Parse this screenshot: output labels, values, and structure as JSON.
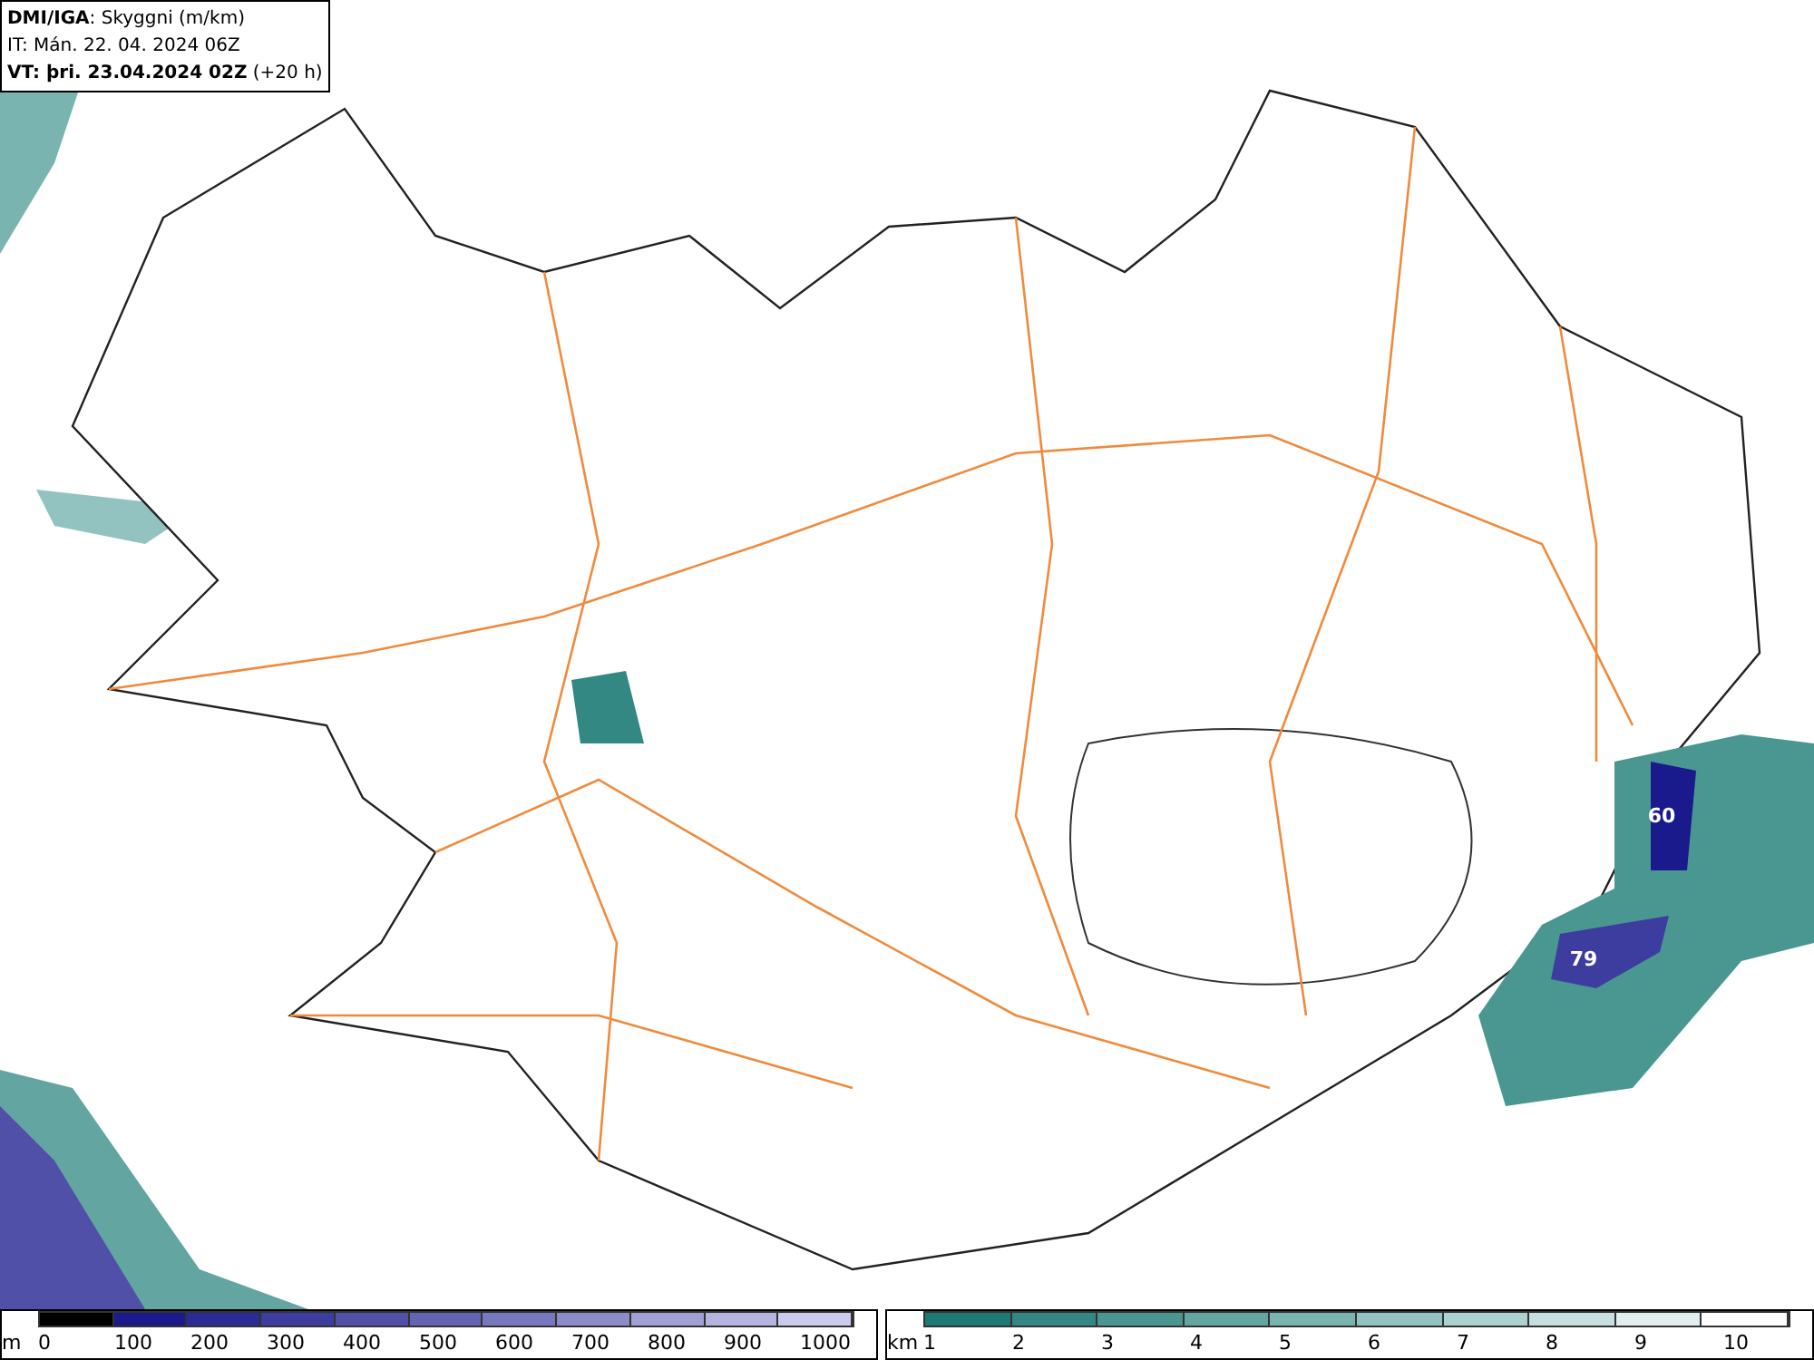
{
  "header": {
    "lines": [
      "**DMI/IGA**: Skyggni (m/km)",
      "IT: Mán. 22. 04. 2024 06Z",
      "**VT: þri. 23.04.2024 02Z** (+20 h)"
    ]
  },
  "map": {
    "labels": [
      {
        "text": "60"
      },
      {
        "text": "79"
      }
    ]
  },
  "legends": [
    {
      "unit": "m",
      "items": [
        {
          "label": "0",
          "color": "#000000"
        },
        {
          "label": "100",
          "color": "#1a1a8c"
        },
        {
          "label": "200",
          "color": "#2b2b96"
        },
        {
          "label": "300",
          "color": "#3d3d9f"
        },
        {
          "label": "400",
          "color": "#5050a8"
        },
        {
          "label": "500",
          "color": "#6464b4"
        },
        {
          "label": "600",
          "color": "#7878bf"
        },
        {
          "label": "700",
          "color": "#8c8cc8"
        },
        {
          "label": "800",
          "color": "#a0a0d4"
        },
        {
          "label": "900",
          "color": "#b4b4df"
        },
        {
          "label": "1000",
          "color": "#cbcbee"
        }
      ]
    },
    {
      "unit": "km",
      "items": [
        {
          "label": "1",
          "color": "#1e7a74"
        },
        {
          "label": "2",
          "color": "#338883"
        },
        {
          "label": "3",
          "color": "#4a9792"
        },
        {
          "label": "4",
          "color": "#62a5a1"
        },
        {
          "label": "5",
          "color": "#7ab4b0"
        },
        {
          "label": "6",
          "color": "#93c3c0"
        },
        {
          "label": "7",
          "color": "#acd2cf"
        },
        {
          "label": "8",
          "color": "#c5e0df"
        },
        {
          "label": "9",
          "color": "#dfeeee"
        },
        {
          "label": "10",
          "color": "#ffffff"
        }
      ]
    }
  ]
}
